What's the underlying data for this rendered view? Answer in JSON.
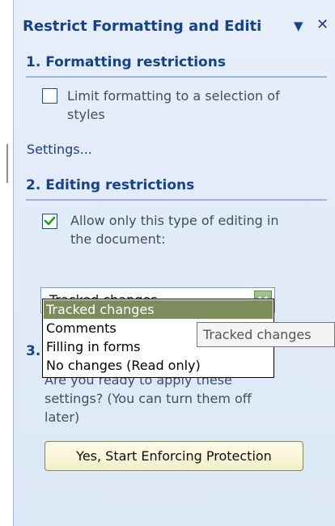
{
  "pane": {
    "title": "Restrict Formatting and Editi",
    "dropdown_glyph": "▼",
    "close_glyph": "✕"
  },
  "section1": {
    "heading": "1. Formatting restrictions",
    "checkbox_checked": false,
    "checkbox_line1": "Limit formatting to a selection of",
    "checkbox_line2": "styles",
    "settings_link": "Settings..."
  },
  "section2": {
    "heading": "2. Editing restrictions",
    "checkbox_checked": true,
    "checkbox_line1": "Allow only this type of editing in",
    "checkbox_line2": "the document:",
    "combo_value": "Tracked changes",
    "options": [
      "Tracked changes",
      "Comments",
      "Filling in forms",
      "No changes (Read only)"
    ],
    "selected_index": 0,
    "tooltip": "Tracked changes"
  },
  "section3": {
    "heading_partial": "3.",
    "line1": "Are you ready to apply these",
    "line2": "settings? (You can turn them off",
    "line3": "later)",
    "button_label": "Yes, Start Enforcing Protection"
  },
  "colors": {
    "heading": "#15428b",
    "pane_bg": "#dde8f6",
    "selected_option": "#7d8c5b",
    "checkmark": "#21a121"
  }
}
